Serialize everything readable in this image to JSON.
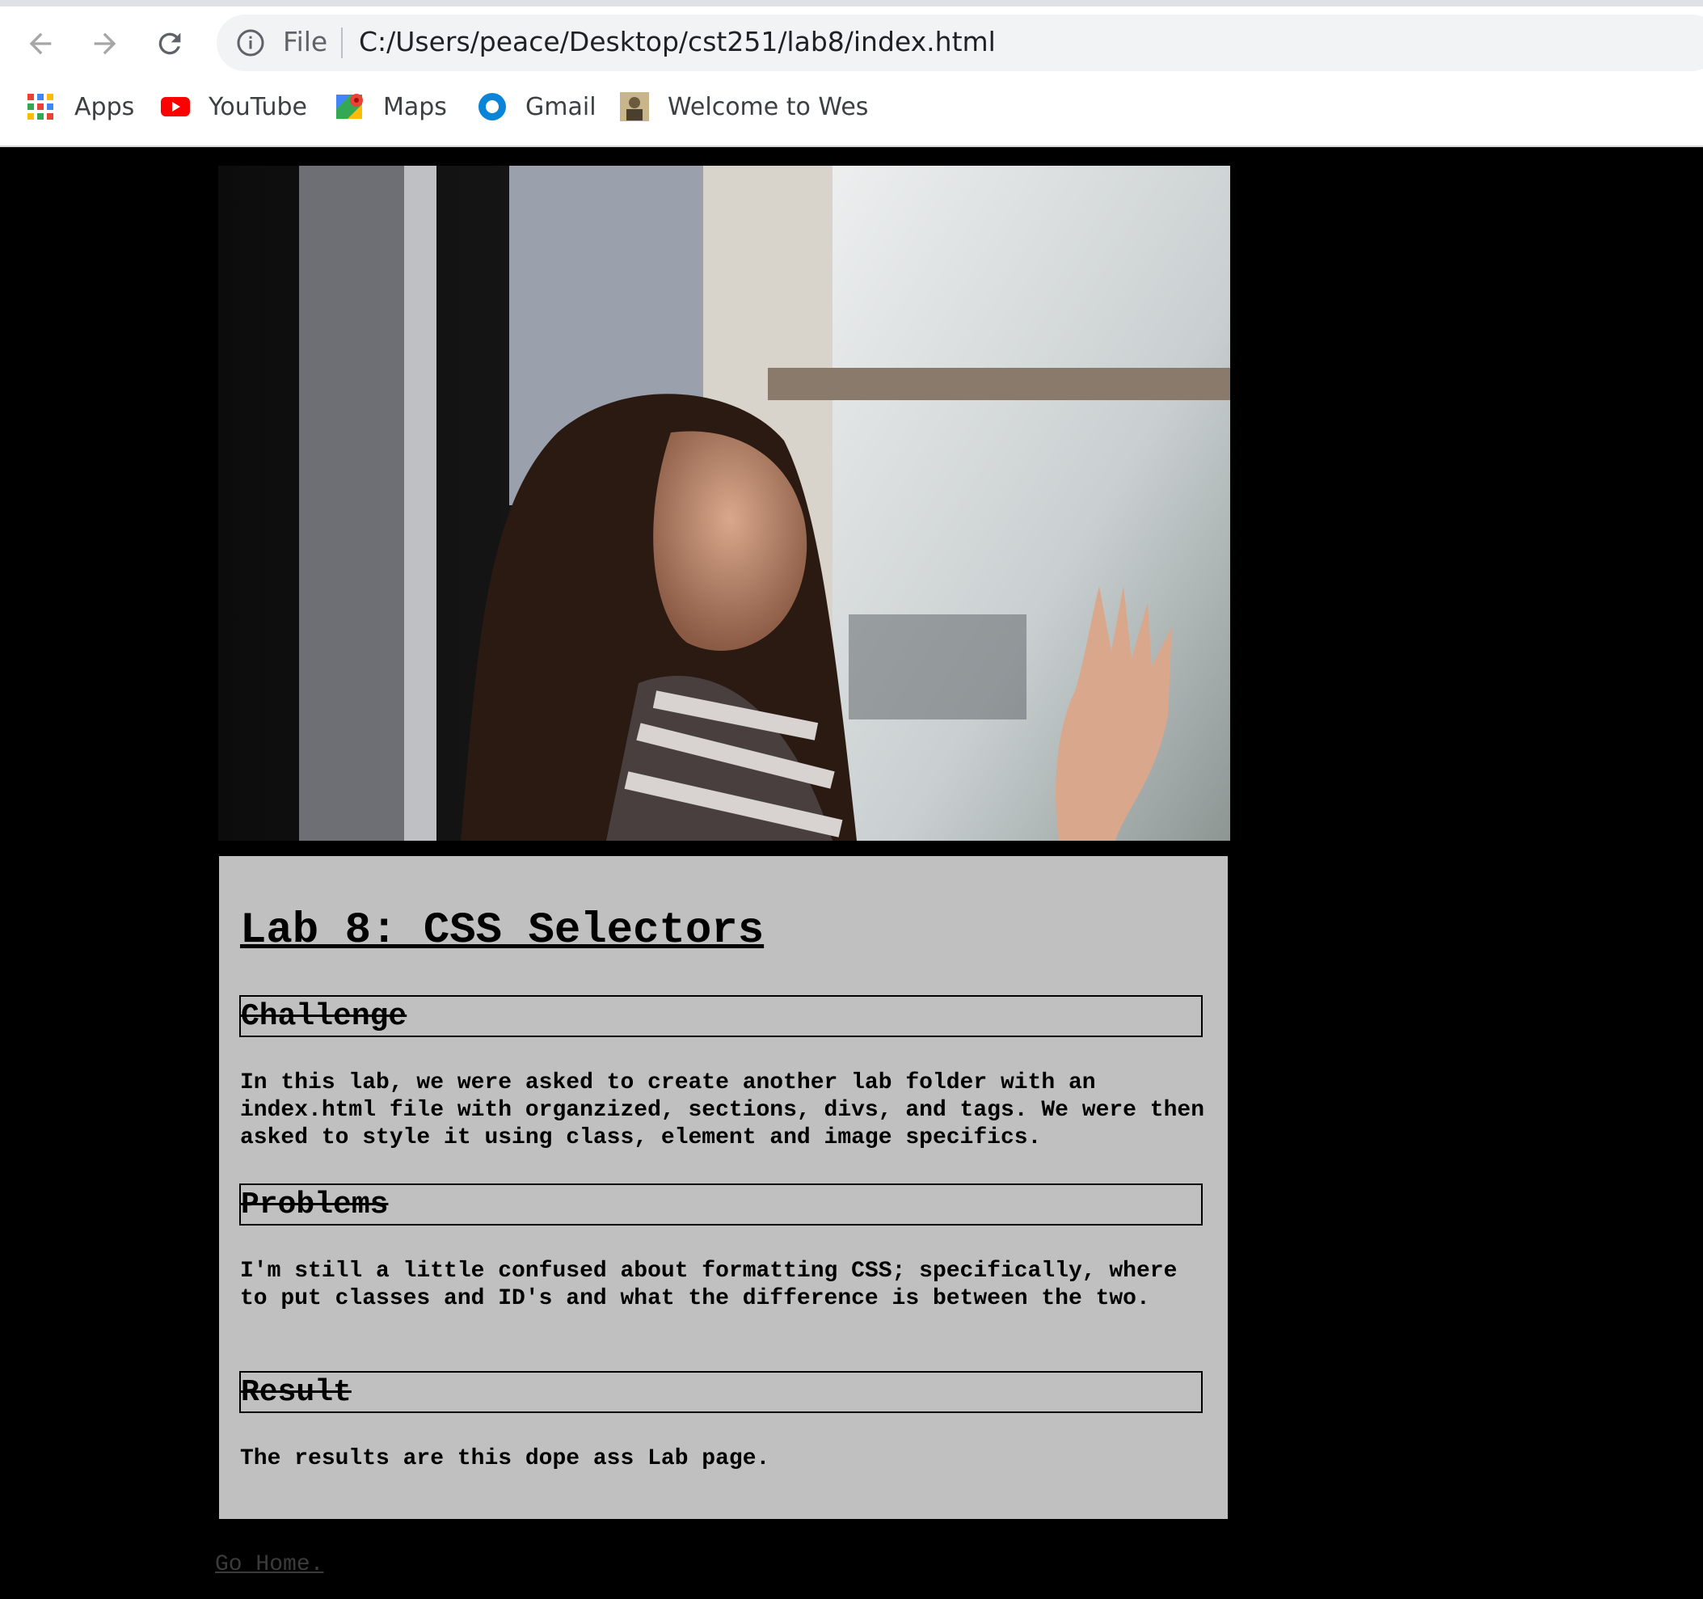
{
  "browser": {
    "omnibox": {
      "scheme_label": "File",
      "url": "C:/Users/peace/Desktop/cst251/lab8/index.html"
    },
    "bookmarks": [
      {
        "label": "Apps",
        "icon": "apps-grid-icon"
      },
      {
        "label": "YouTube",
        "icon": "youtube-icon"
      },
      {
        "label": "Maps",
        "icon": "maps-icon"
      },
      {
        "label": "Gmail",
        "icon": "gmail-icon"
      },
      {
        "label": "Welcome to Wes",
        "icon": "site-favicon-icon"
      }
    ]
  },
  "page": {
    "title": "Lab 8: CSS Selectors",
    "sections": [
      {
        "heading": "Challenge",
        "body": "In this lab, we were asked to create another lab folder with an index.html file with organzized, sections, divs, and tags. We were then asked to style it using class, element and image specifics."
      },
      {
        "heading": "Problems",
        "body": "I'm still a little confused about formatting CSS; specifically, where to put classes and ID's and what the difference is between the two."
      },
      {
        "heading": "Result",
        "body": "The results are this dope ass Lab page."
      }
    ],
    "home_link": "Go Home."
  },
  "colors": {
    "page_background": "#000000",
    "card_background": "#c0c0c0",
    "text": "#000000"
  }
}
